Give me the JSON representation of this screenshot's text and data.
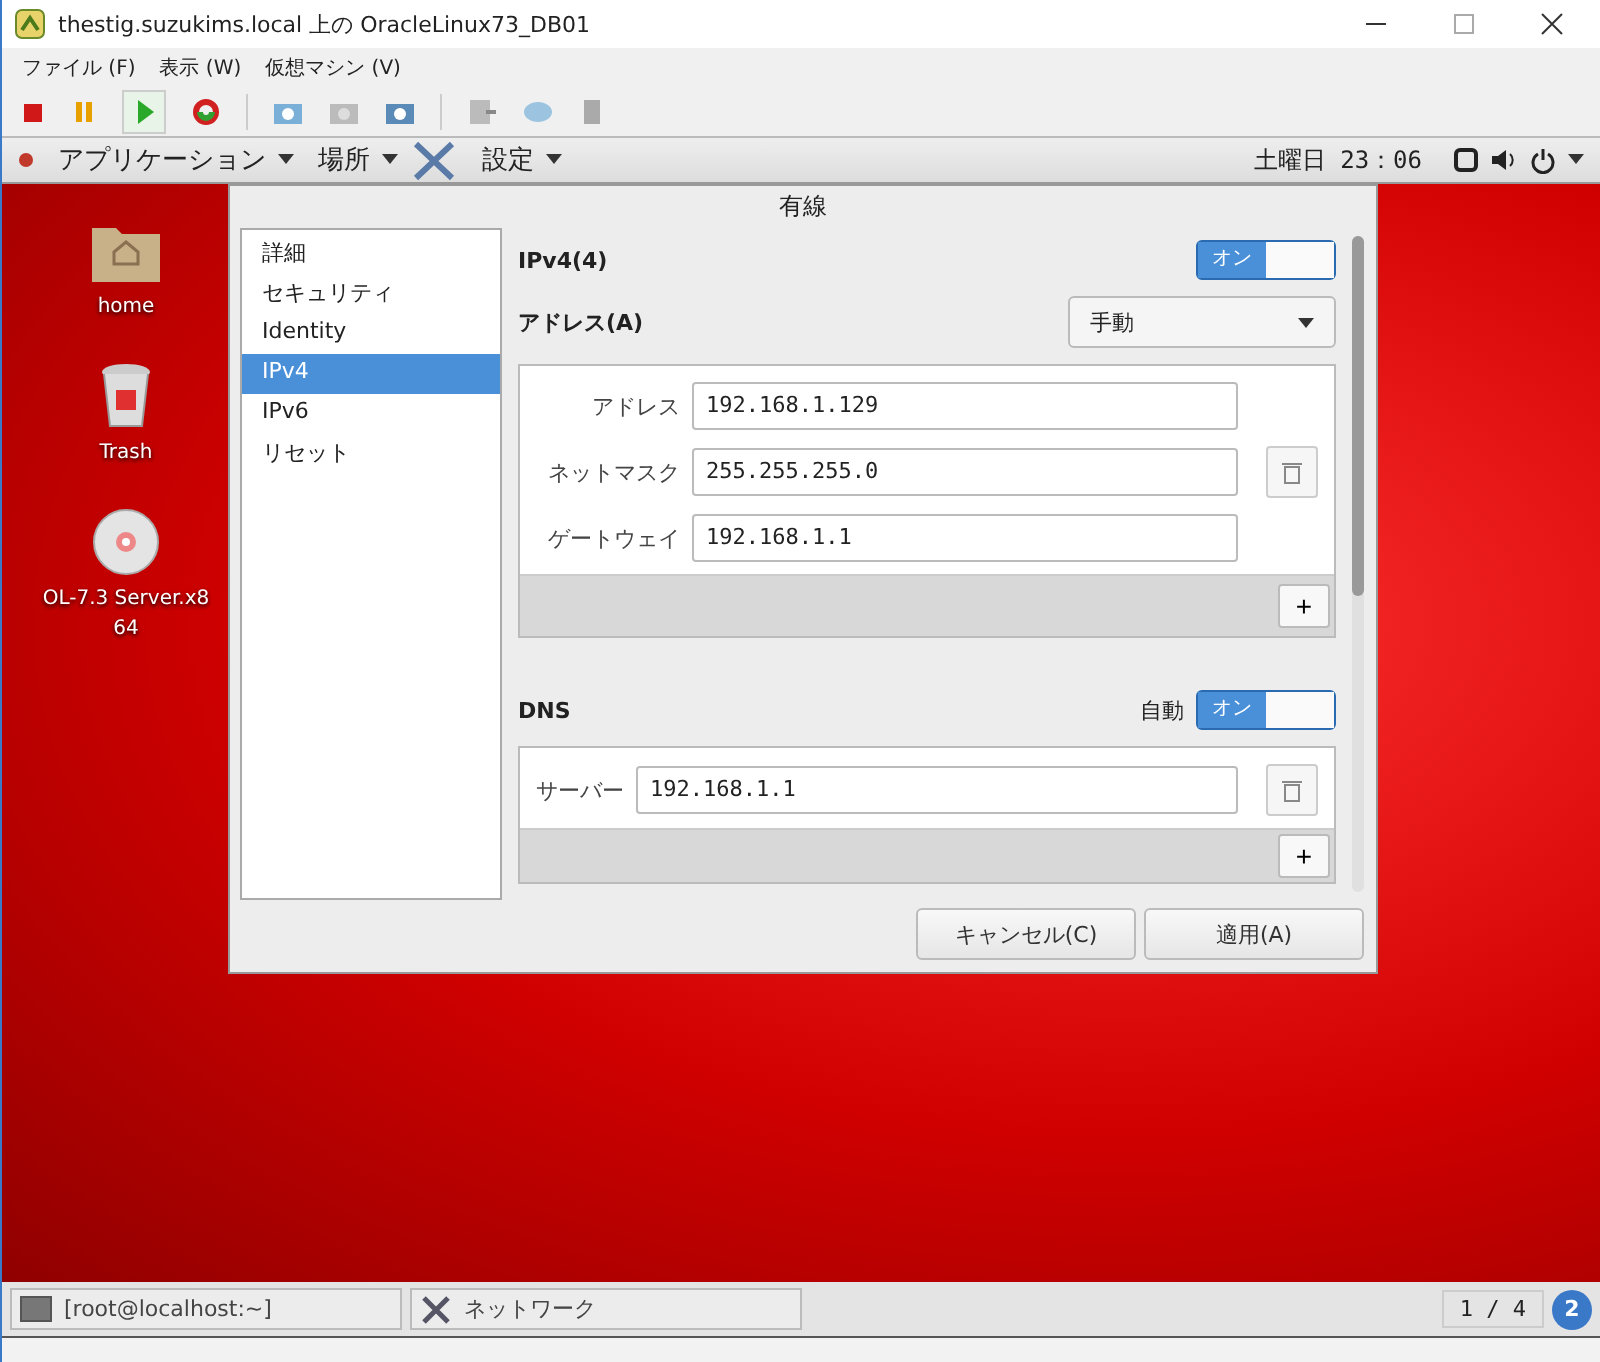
{
  "host_window": {
    "title": "thestig.suzukims.local 上の OracleLinux73_DB01",
    "menu": [
      "ファイル (F)",
      "表示 (W)",
      "仮想マシン (V)"
    ]
  },
  "top_bar": {
    "menus": [
      "アプリケーション",
      "場所",
      "設定"
    ],
    "clock": "土曜日 23：06"
  },
  "desktop_icons": [
    {
      "kind": "folder",
      "lines": [
        "home"
      ]
    },
    {
      "kind": "trash",
      "lines": [
        "Trash"
      ]
    },
    {
      "kind": "disc",
      "lines": [
        "OL-7.3 Server.x8",
        "64"
      ]
    }
  ],
  "dialog": {
    "title": "有線",
    "sidebar": [
      {
        "label": "詳細",
        "selected": false
      },
      {
        "label": "セキュリティ",
        "selected": false
      },
      {
        "label": "Identity",
        "selected": false
      },
      {
        "label": "IPv4",
        "selected": true
      },
      {
        "label": "IPv6",
        "selected": false
      },
      {
        "label": "リセット",
        "selected": false
      }
    ],
    "ipv4": {
      "heading": "IPv4(4)",
      "switch": {
        "label": "オン",
        "on": true
      },
      "method_label": "アドレス(A)",
      "method": "手動",
      "fields": [
        {
          "label": "アドレス",
          "value": "192.168.1.129"
        },
        {
          "label": "ネットマスク",
          "value": "255.255.255.0"
        },
        {
          "label": "ゲートウェイ",
          "value": "192.168.1.1"
        }
      ],
      "add": "+"
    },
    "dns": {
      "heading": "DNS",
      "auto_label": "自動",
      "switch": {
        "label": "オン",
        "on": true
      },
      "servers": [
        {
          "label": "サーバー",
          "value": "192.168.1.1"
        }
      ],
      "add": "+"
    },
    "buttons": [
      "キャンセル(C)",
      "適用(A)"
    ]
  },
  "taskbar": {
    "items": [
      "[root@localhost:~]",
      "ネットワーク"
    ],
    "workspace": "1 / 4",
    "badge": "2"
  }
}
